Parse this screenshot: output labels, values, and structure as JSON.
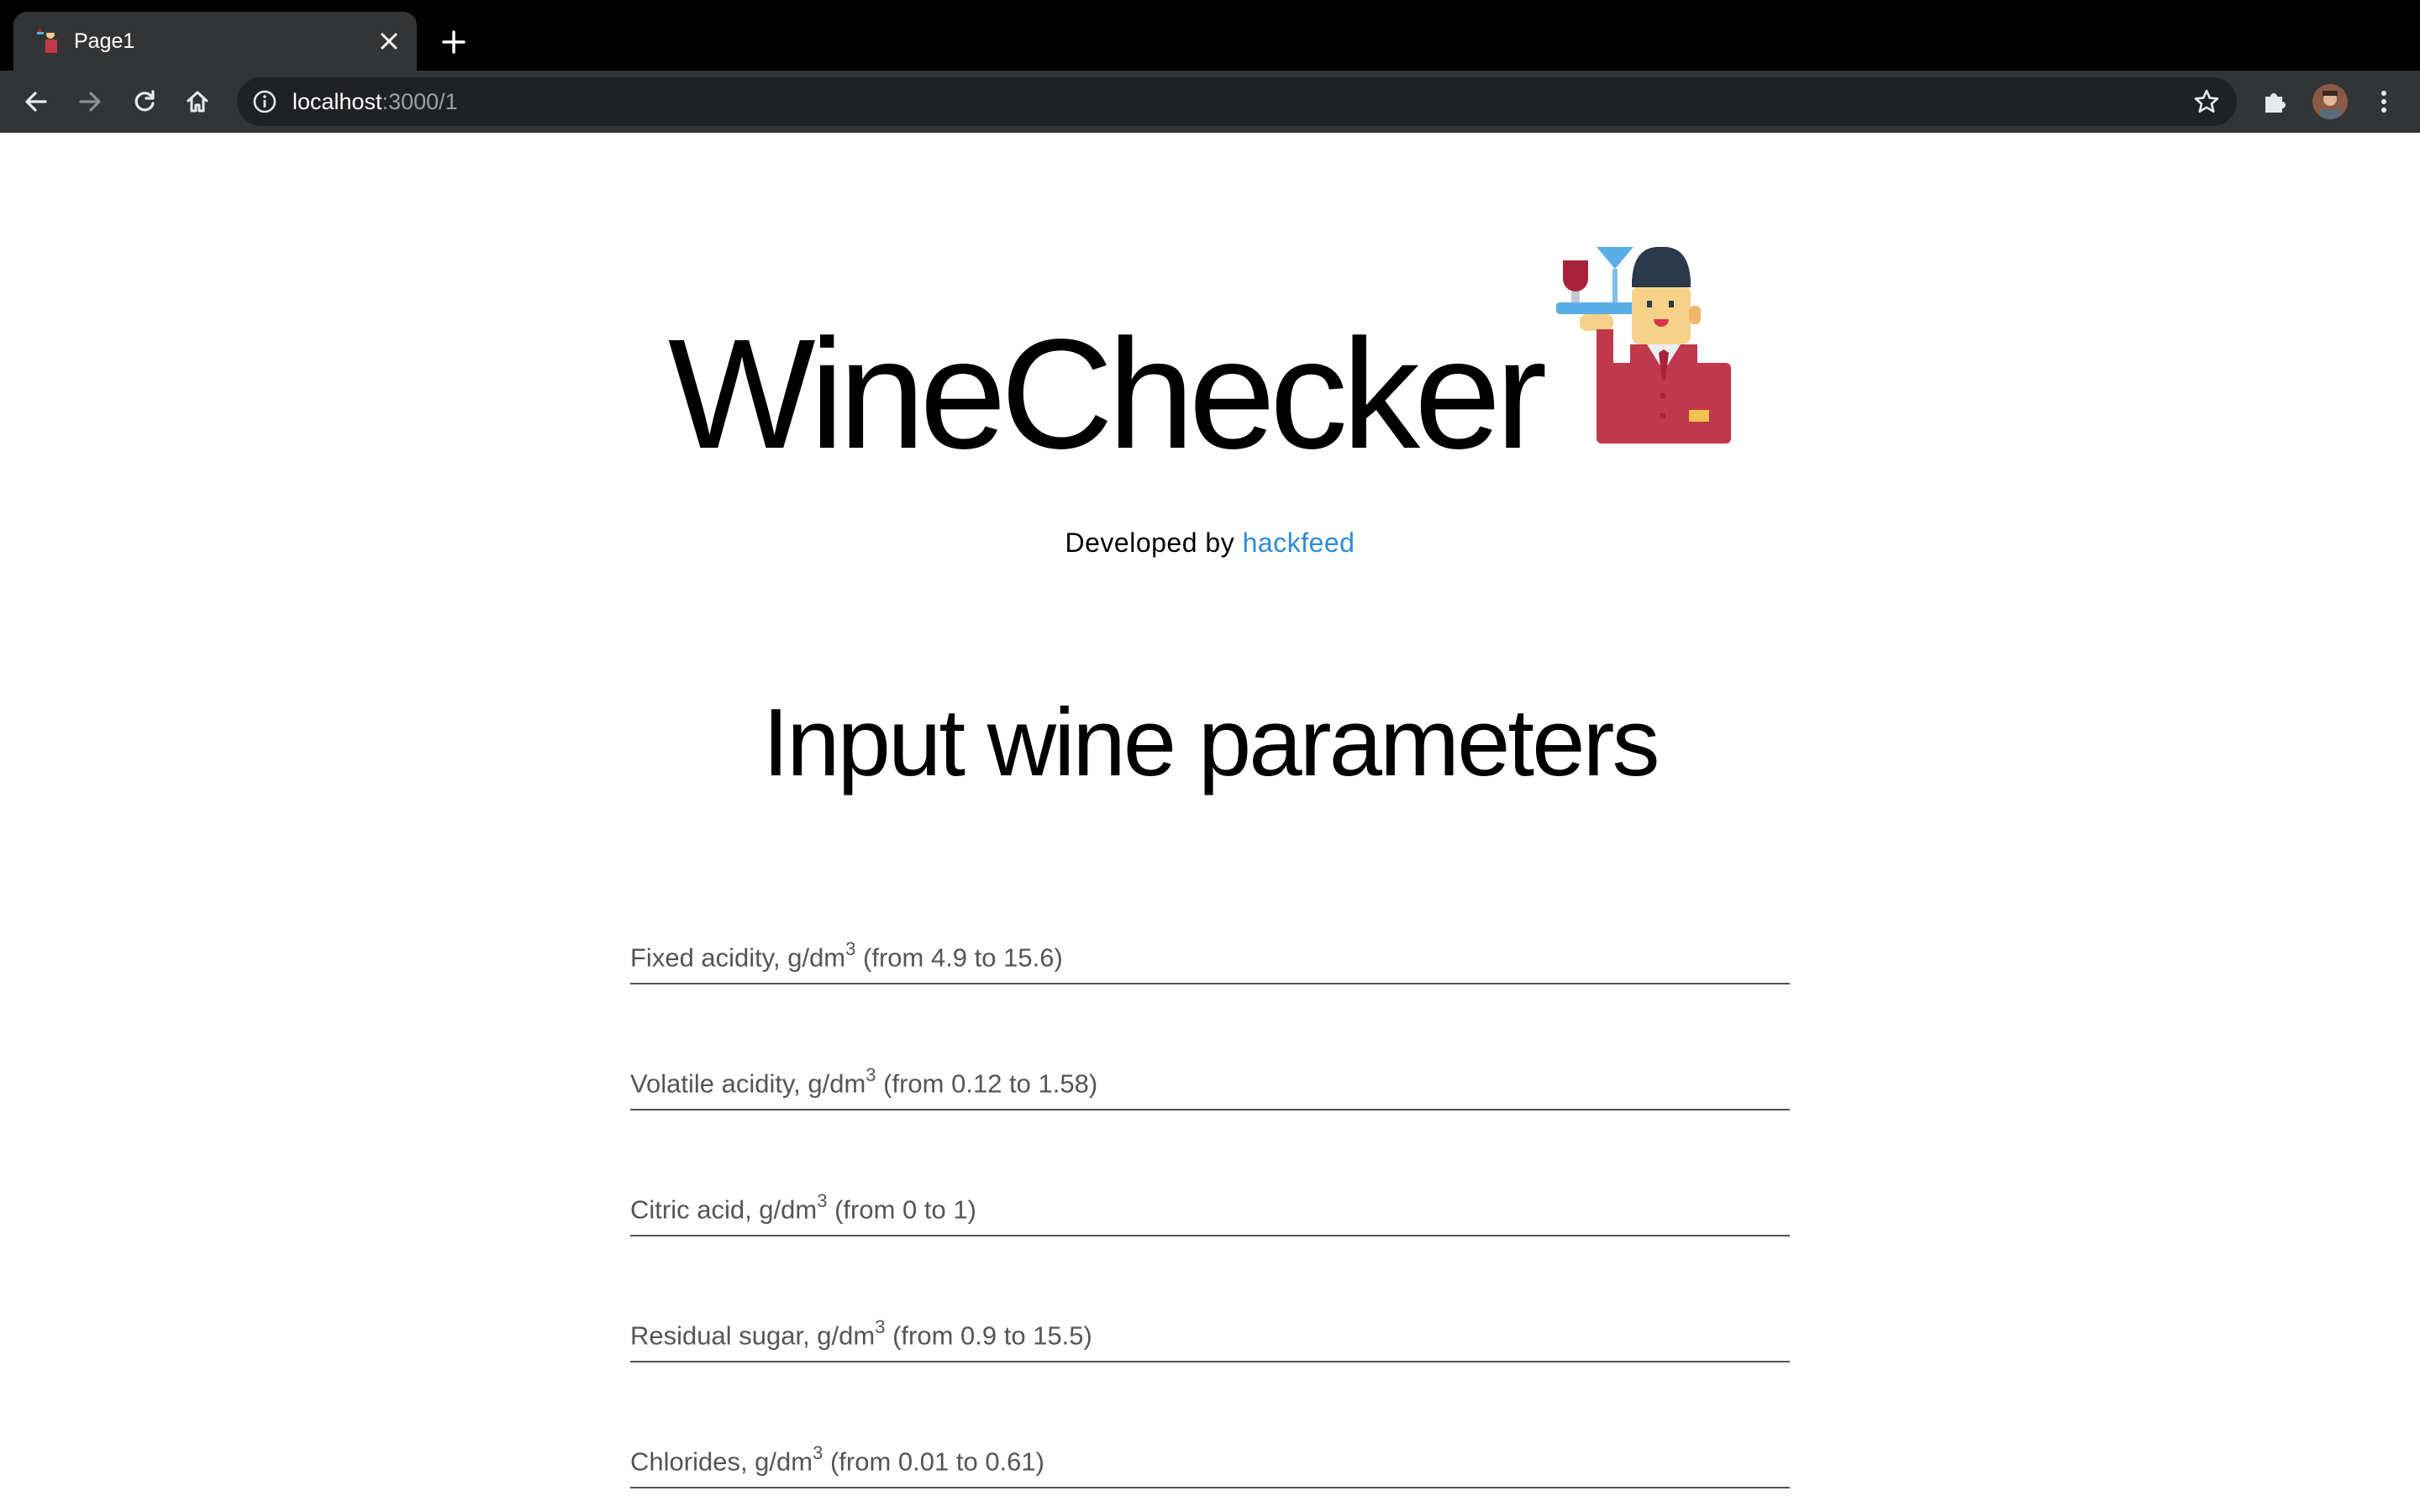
{
  "browser": {
    "tab_title": "Page1",
    "url_host": "localhost",
    "url_rest": ":3000/1"
  },
  "header": {
    "title": "WineChecker",
    "developed_prefix": "Developed by",
    "developed_link": "hackfeed"
  },
  "form": {
    "title": "Input wine parameters",
    "fields": [
      {
        "name": "Fixed acidity, g/dm",
        "sup": "3",
        "range": "(from 4.9 to 15.6)"
      },
      {
        "name": "Volatile acidity, g/dm",
        "sup": "3",
        "range": "(from 0.12 to 1.58)"
      },
      {
        "name": "Citric acid, g/dm",
        "sup": "3",
        "range": "(from 0 to 1)"
      },
      {
        "name": "Residual sugar, g/dm",
        "sup": "3",
        "range": "(from 0.9 to 15.5)"
      },
      {
        "name": "Chlorides, g/dm",
        "sup": "3",
        "range": "(from 0.01 to 0.61)"
      }
    ]
  },
  "colors": {
    "link": "#2e8bd6",
    "chrome_dark": "#000000",
    "chrome_toolbar": "#333436"
  }
}
